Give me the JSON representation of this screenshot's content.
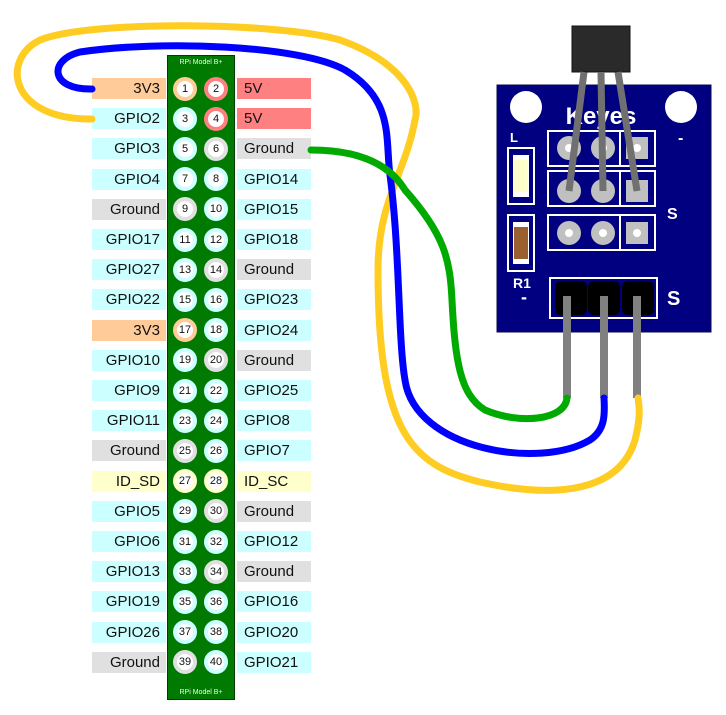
{
  "board": {
    "name_top": "RPi Model B+",
    "name_bottom": "RPi Model B+"
  },
  "colors": {
    "power_3v3": "#ffcc99",
    "power_5v": "#ff8080",
    "gpio": "#ccffff",
    "ground": "#e0e0e0",
    "id_eeprom": "#ffffcc",
    "header_green": "#007a00",
    "wire_yellow": "#ffcc22",
    "wire_blue": "#0000ff",
    "wire_green": "#00aa00",
    "sensor_pcb": "#000080"
  },
  "pins": [
    {
      "num": "1",
      "label": "3V3",
      "type": "power_3v3"
    },
    {
      "num": "2",
      "label": "5V",
      "type": "power_5v"
    },
    {
      "num": "3",
      "label": "GPIO2",
      "type": "gpio"
    },
    {
      "num": "4",
      "label": "5V",
      "type": "power_5v"
    },
    {
      "num": "5",
      "label": "GPIO3",
      "type": "gpio"
    },
    {
      "num": "6",
      "label": "Ground",
      "type": "ground"
    },
    {
      "num": "7",
      "label": "GPIO4",
      "type": "gpio"
    },
    {
      "num": "8",
      "label": "GPIO14",
      "type": "gpio"
    },
    {
      "num": "9",
      "label": "Ground",
      "type": "ground"
    },
    {
      "num": "10",
      "label": "GPIO15",
      "type": "gpio"
    },
    {
      "num": "11",
      "label": "GPIO17",
      "type": "gpio"
    },
    {
      "num": "12",
      "label": "GPIO18",
      "type": "gpio"
    },
    {
      "num": "13",
      "label": "GPIO27",
      "type": "gpio"
    },
    {
      "num": "14",
      "label": "Ground",
      "type": "ground"
    },
    {
      "num": "15",
      "label": "GPIO22",
      "type": "gpio"
    },
    {
      "num": "16",
      "label": "GPIO23",
      "type": "gpio"
    },
    {
      "num": "17",
      "label": "3V3",
      "type": "power_3v3"
    },
    {
      "num": "18",
      "label": "GPIO24",
      "type": "gpio"
    },
    {
      "num": "19",
      "label": "GPIO10",
      "type": "gpio"
    },
    {
      "num": "20",
      "label": "Ground",
      "type": "ground"
    },
    {
      "num": "21",
      "label": "GPIO9",
      "type": "gpio"
    },
    {
      "num": "22",
      "label": "GPIO25",
      "type": "gpio"
    },
    {
      "num": "23",
      "label": "GPIO11",
      "type": "gpio"
    },
    {
      "num": "24",
      "label": "GPIO8",
      "type": "gpio"
    },
    {
      "num": "25",
      "label": "Ground",
      "type": "ground"
    },
    {
      "num": "26",
      "label": "GPIO7",
      "type": "gpio"
    },
    {
      "num": "27",
      "label": "ID_SD",
      "type": "id_eeprom"
    },
    {
      "num": "28",
      "label": "ID_SC",
      "type": "id_eeprom"
    },
    {
      "num": "29",
      "label": "GPIO5",
      "type": "gpio"
    },
    {
      "num": "30",
      "label": "Ground",
      "type": "ground"
    },
    {
      "num": "31",
      "label": "GPIO6",
      "type": "gpio"
    },
    {
      "num": "32",
      "label": "GPIO12",
      "type": "gpio"
    },
    {
      "num": "33",
      "label": "GPIO13",
      "type": "gpio"
    },
    {
      "num": "34",
      "label": "Ground",
      "type": "ground"
    },
    {
      "num": "35",
      "label": "GPIO19",
      "type": "gpio"
    },
    {
      "num": "36",
      "label": "GPIO16",
      "type": "gpio"
    },
    {
      "num": "37",
      "label": "GPIO26",
      "type": "gpio"
    },
    {
      "num": "38",
      "label": "GPIO20",
      "type": "gpio"
    },
    {
      "num": "39",
      "label": "Ground",
      "type": "ground"
    },
    {
      "num": "40",
      "label": "GPIO21",
      "type": "gpio"
    }
  ],
  "sensor": {
    "brand": "Keyes",
    "marking_minus_top": "-",
    "marking_s_mid": "S",
    "marking_l": "L",
    "marking_r1": "R1",
    "pin_minus": "-",
    "pin_s": "S"
  },
  "wires": [
    {
      "color": "wire_yellow",
      "from_pin": "3",
      "to": "sensor S pin"
    },
    {
      "color": "wire_blue",
      "from_pin": "1",
      "to": "sensor middle pin"
    },
    {
      "color": "wire_green",
      "from_pin": "6",
      "to": "sensor - pin"
    }
  ]
}
